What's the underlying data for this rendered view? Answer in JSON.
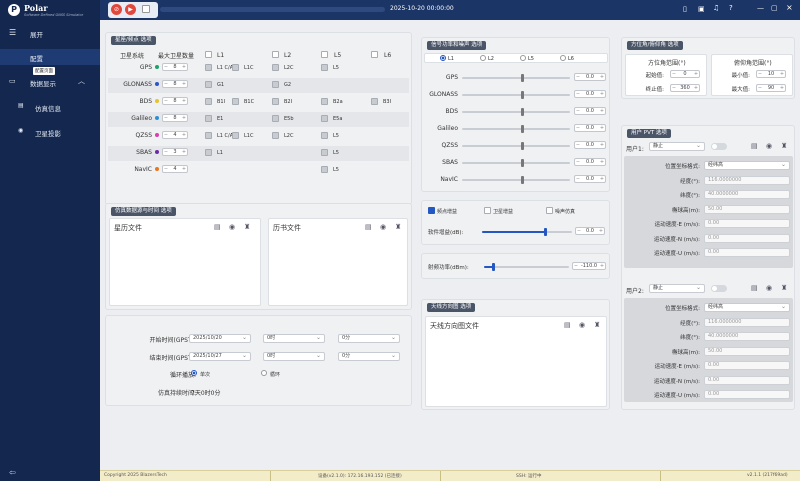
{
  "app": {
    "name": "Polar",
    "subtitle": "Software Defined GNSS Simulator",
    "datetime": "2025-10-20 00:00:00"
  },
  "sidebar": {
    "expand": "展开",
    "config": "配置",
    "config_tooltip": "配置页面",
    "data_display": "数据显示",
    "sim_info": "仿真信息",
    "sat_projection": "卫星投影"
  },
  "sat": {
    "title": "星座/频点 选项",
    "col_system": "卫星系统",
    "col_count": "最大卫星数量",
    "l1": "L1",
    "l2": "L2",
    "l5": "L5",
    "l6": "L6",
    "rows": [
      {
        "name": "GPS",
        "color": "#1aa36a",
        "count": "8",
        "freqs": [
          "L1 C/A",
          "L1C",
          "L2C",
          "L5"
        ]
      },
      {
        "name": "GLONASS",
        "color": "#2b55c8",
        "count": "8",
        "freqs": [
          "G1",
          "G2"
        ]
      },
      {
        "name": "BDS",
        "color": "#e6c42a",
        "count": "8",
        "freqs": [
          "B1I",
          "B1C",
          "B2I",
          "B2a",
          "B3I"
        ]
      },
      {
        "name": "Galileo",
        "color": "#2b8fd6",
        "count": "8",
        "freqs": [
          "E1",
          "E5b",
          "E5a"
        ]
      },
      {
        "name": "QZSS",
        "color": "#d93fb5",
        "count": "4",
        "freqs": [
          "L1 C/A",
          "L1C",
          "L2C",
          "L5"
        ]
      },
      {
        "name": "SBAS",
        "color": "#6b2ca8",
        "count": "3",
        "freqs": [
          "L1",
          "L5"
        ]
      },
      {
        "name": "NavIC",
        "color": "#e87722",
        "count": "4",
        "freqs": [
          "L5"
        ]
      }
    ]
  },
  "power": {
    "title": "信号功率和噪声 选项",
    "bands": [
      "L1",
      "L2",
      "L5",
      "L6"
    ],
    "rows": [
      {
        "name": "GPS",
        "value": "0.0",
        "level": 0.55
      },
      {
        "name": "GLONASS",
        "value": "0.0",
        "level": 0.55
      },
      {
        "name": "BDS",
        "value": "0.0",
        "level": 0.55
      },
      {
        "name": "Galileo",
        "value": "0.0",
        "level": 0.55
      },
      {
        "name": "QZSS",
        "value": "0.0",
        "level": 0.55
      },
      {
        "name": "SBAS",
        "value": "0.0",
        "level": 0.55
      },
      {
        "name": "NavIC",
        "value": "0.0",
        "level": 0.55
      }
    ],
    "freq_gain": "频点增益",
    "sat_gain": "卫星增益",
    "noise_sim": "噪声仿真",
    "sw_gain_label": "软件增益(dB):",
    "sw_gain": "0.0",
    "sw_gain_level": 0.7,
    "rf_label": "射频功率(dBm):",
    "rf_value": "-110.0",
    "rf_level": 0.1
  },
  "range": {
    "title": "方位角/俯仰角 选项",
    "az_head": "方位角范围(°)",
    "el_head": "俯仰角范围(°)",
    "start": "起始值:",
    "end": "终止值:",
    "min": "最小值:",
    "max": "最大值:",
    "az_start": "0",
    "az_end": "360",
    "el_min": "10",
    "el_max": "90"
  },
  "user": {
    "title": "用户 PVT 选项",
    "users": [
      {
        "label": "用户1:",
        "state": "静止",
        "format_label": "位置坐标格式:",
        "format": "经纬高",
        "lon_label": "经度(°):",
        "lon": "116.0000000",
        "lat_label": "纬度(°):",
        "lat": "40.0000000",
        "alt_label": "椭球高(m):",
        "alt": "50.00",
        "ve_label": "运动速度-E (m/s):",
        "ve": "0.00",
        "vn_label": "运动速度-N (m/s):",
        "vn": "0.00",
        "vu_label": "运动速度-U (m/s):",
        "vu": "0.00"
      },
      {
        "label": "用户2:",
        "state": "静止",
        "format_label": "位置坐标格式:",
        "format": "经纬高",
        "lon_label": "经度(°):",
        "lon": "116.0000000",
        "lat_label": "纬度(°):",
        "lat": "40.0000000",
        "alt_label": "椭球高(m):",
        "alt": "50.00",
        "ve_label": "运动速度-E (m/s):",
        "ve": "0.00",
        "vn_label": "运动速度-N (m/s):",
        "vn": "0.00",
        "vu_label": "运动速度-U (m/s):",
        "vu": "0.00"
      }
    ]
  },
  "data_src": {
    "title": "仿真数据源与时间 选项",
    "ephem": "星历文件",
    "almanac": "历书文件"
  },
  "time": {
    "start_label": "开始时间(GPST):",
    "start_date": "2025/10/20",
    "start_hour": "0时",
    "start_min": "0分",
    "end_label": "结束时间(GPST):",
    "end_date": "2025/10/27",
    "end_hour": "0时",
    "end_min": "0分",
    "loop_label": "循环播放:",
    "single": "单次",
    "loop": "循环",
    "dur_label": "仿真持续时间:",
    "duration": "7天0时0分"
  },
  "antenna": {
    "title": "天线方向图 选项",
    "file": "天线方向图文件"
  },
  "footer": {
    "copyright": "Copyright 2025 BlazersTech",
    "device": "设备(v2.1.0): 172.16.193.152 (已连接)",
    "ssh": "SSH: 运行中",
    "version": "v2.1.1 (217f69ad)"
  },
  "colors": {
    "sidebar": "#14284f",
    "topbar": "#1b3566",
    "accent": "#2456c4",
    "close": "#e0483e"
  }
}
